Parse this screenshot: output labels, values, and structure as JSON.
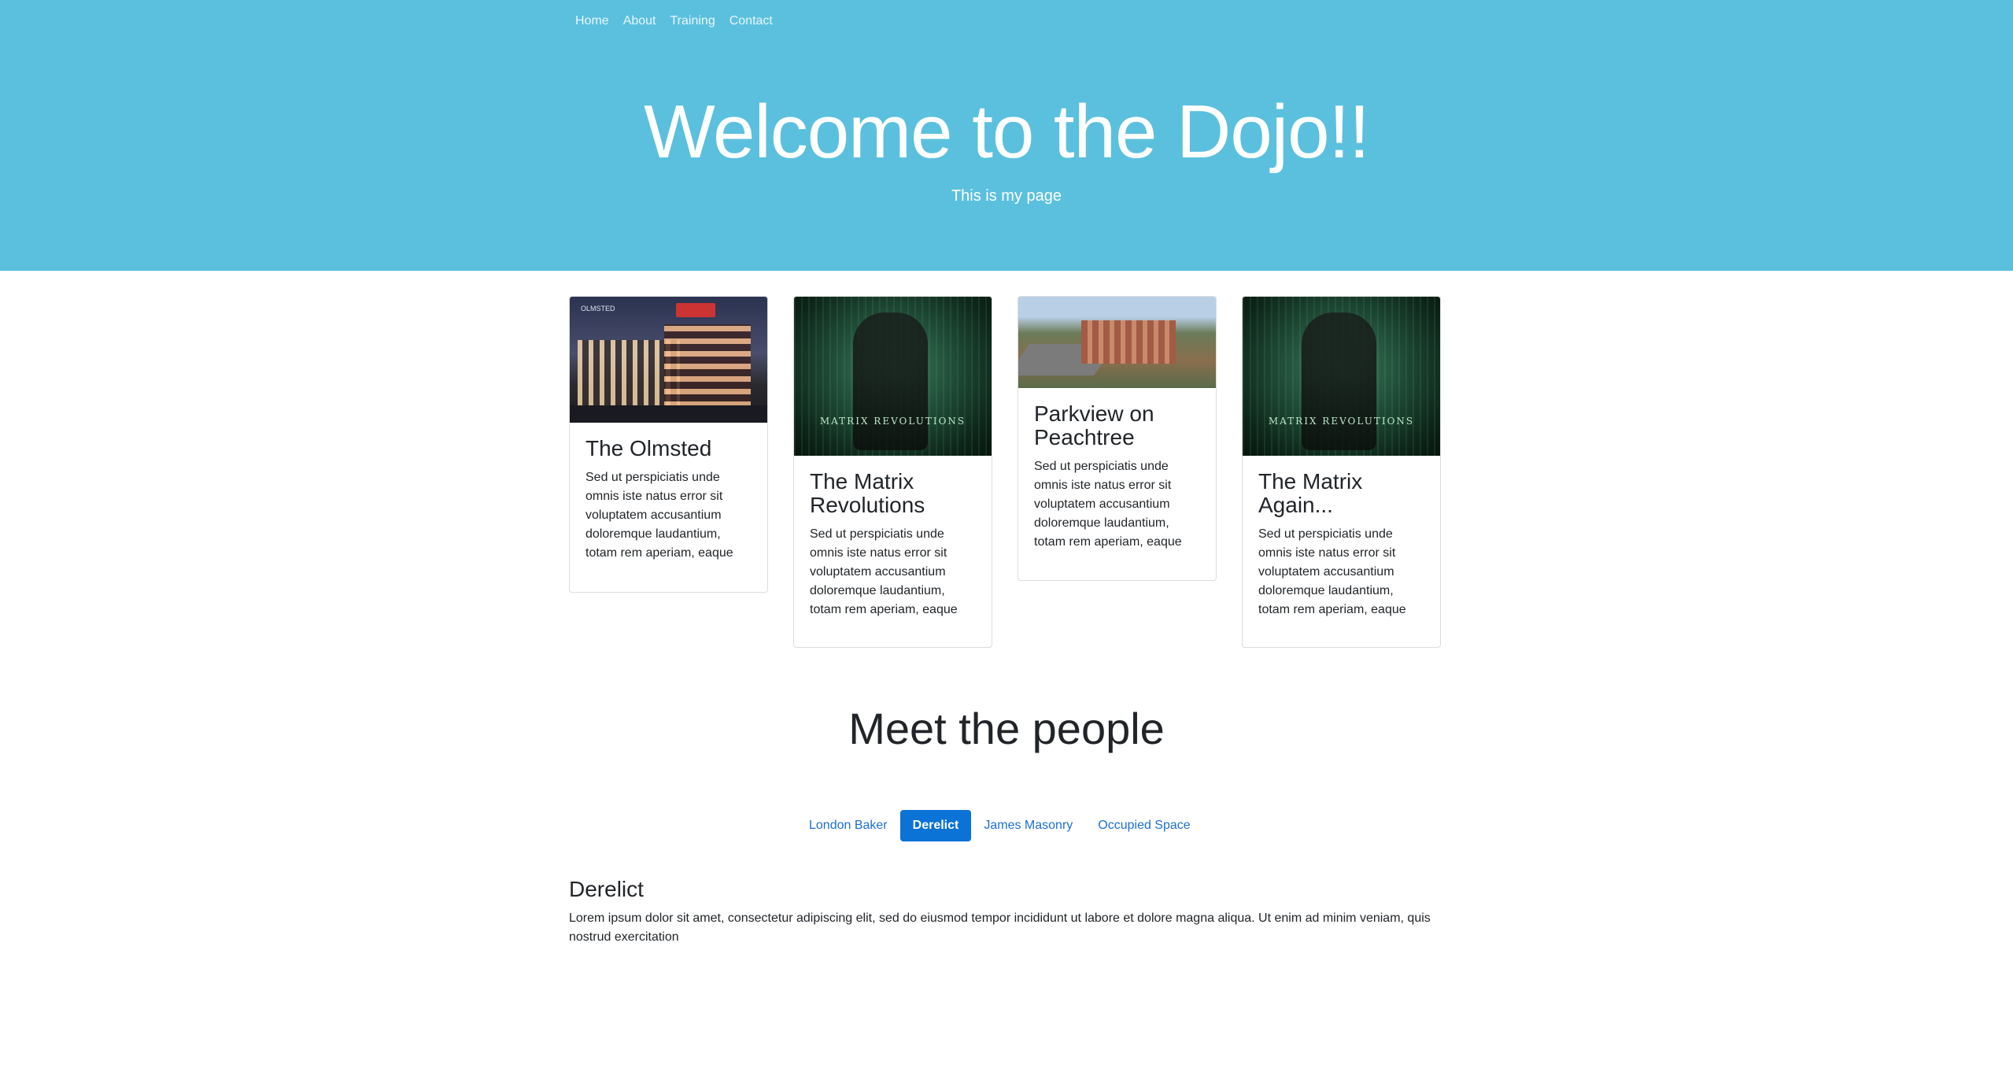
{
  "nav": {
    "items": [
      "Home",
      "About",
      "Training",
      "Contact"
    ]
  },
  "hero": {
    "title": "Welcome to the Dojo!!",
    "subtitle": "This is my page",
    "background": "#5bc0de"
  },
  "cards": [
    {
      "title": "The Olmsted",
      "text": "Sed ut perspiciatis unde omnis iste natus error sit voluptatem accusantium doloremque laudantium, totam rem aperiam, eaque",
      "image_logo_text": "OLMSTED"
    },
    {
      "title": "The Matrix Revolutions",
      "text": "Sed ut perspiciatis unde omnis iste natus error sit voluptatem accusantium doloremque laudantium, totam rem aperiam, eaque",
      "image_text": "MATRIX REVOLUTIONS"
    },
    {
      "title": "Parkview on Peachtree",
      "text": "Sed ut perspiciatis unde omnis iste natus error sit voluptatem accusantium doloremque laudantium, totam rem aperiam, eaque"
    },
    {
      "title": "The Matrix Again...",
      "text": "Sed ut perspiciatis unde omnis iste natus error sit voluptatem accusantium doloremque laudantium, totam rem aperiam, eaque",
      "image_text": "MATRIX REVOLUTIONS"
    }
  ],
  "people": {
    "title": "Meet the people",
    "tabs": [
      "London Baker",
      "Derelict",
      "James Masonry",
      "Occupied Space"
    ],
    "active_tab": "Derelict",
    "panel_title": "Derelict",
    "panel_text": "Lorem ipsum dolor sit amet, consectetur adipiscing elit, sed do eiusmod tempor incididunt ut labore et dolore magna aliqua. Ut enim ad minim veniam, quis nostrud exercitation"
  },
  "colors": {
    "accent": "#0b72d6",
    "hero_bg": "#5bc0de"
  }
}
